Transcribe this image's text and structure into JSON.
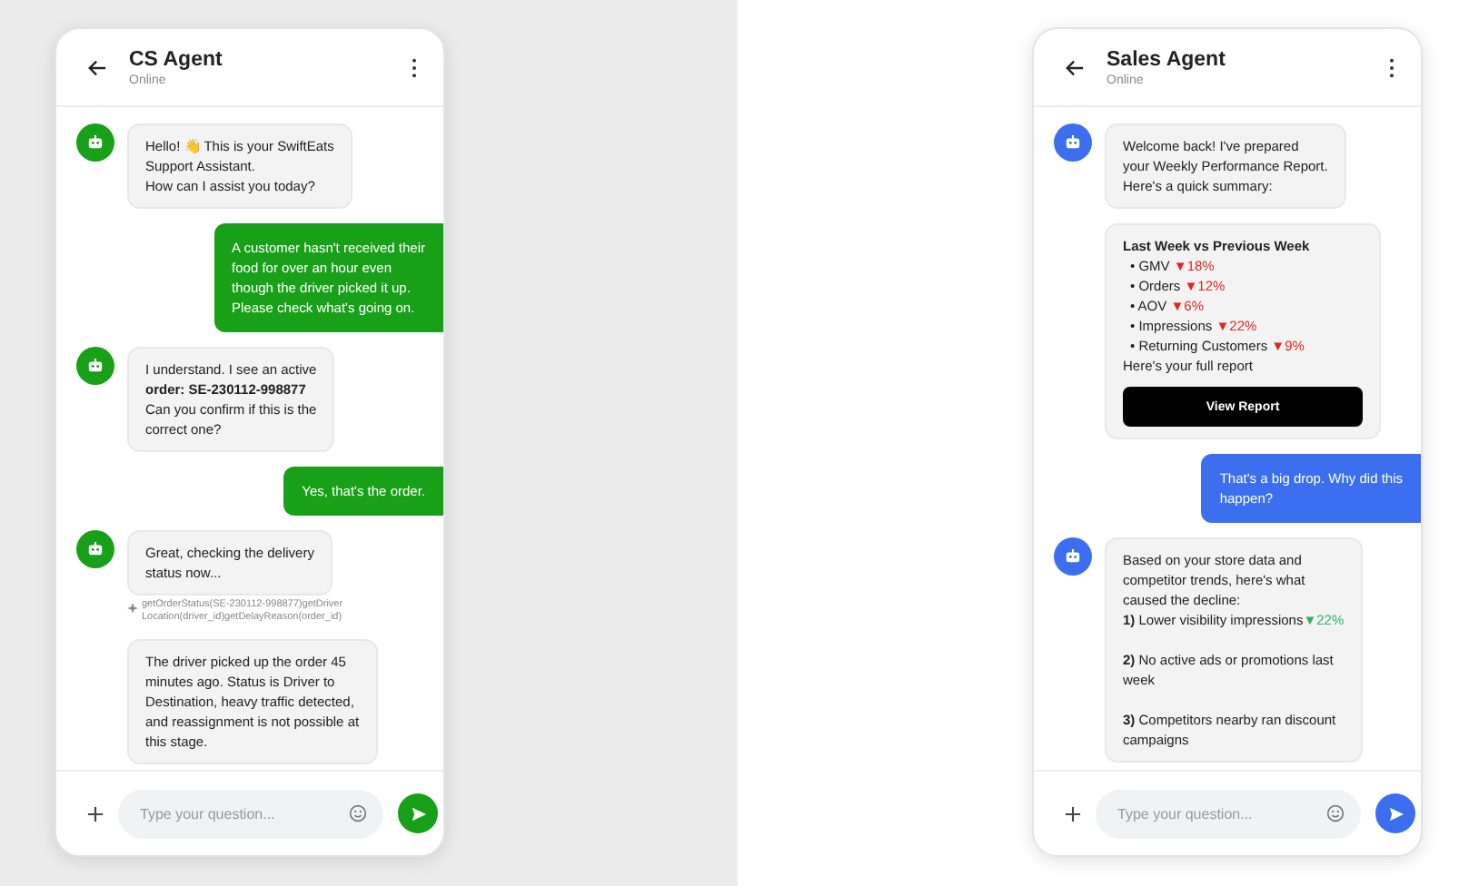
{
  "phones": [
    {
      "title": "CS Agent",
      "status": "Online",
      "color": "#18a018",
      "input": {
        "placeholder": "Type your question..."
      },
      "messages": [
        {
          "kind": "bot",
          "avatar": true,
          "blocks": [
            {
              "text": "Hello! 👋 This is your SwiftEats\nSupport Assistant.\nHow can I assist you today?"
            }
          ]
        },
        {
          "kind": "user",
          "text": "A customer hasn't received their\nfood for over an hour even\nthough the driver picked it up.\nPlease check what's going on."
        },
        {
          "kind": "bot",
          "avatar": true,
          "blocks": [
            {
              "text": "I understand. I see an active\n**order: SE-230112-998877**\nCan you confirm if this is the\ncorrect one?"
            }
          ]
        },
        {
          "kind": "user",
          "text": "Yes, that's the order."
        },
        {
          "kind": "bot",
          "avatar": true,
          "blocks": [
            {
              "text": "Great, checking the delivery\nstatus now..."
            }
          ]
        },
        {
          "kind": "tool",
          "text": "getOrderStatus(SE-230112-998877)getDriver\nLocation(driver_id)getDelayReason(order_id)"
        },
        {
          "kind": "bot",
          "avatar": false,
          "blocks": [
            {
              "text": "The driver picked up the order 45\nminutes ago. Status is Driver to\nDestination, heavy traffic detected,\nand reassignment is not possible at\nthis stage."
            }
          ]
        }
      ]
    },
    {
      "title": "Sales Agent",
      "status": "Online",
      "color": "#3b6ff0",
      "input": {
        "placeholder": "Type your question..."
      },
      "messages": [
        {
          "kind": "bot",
          "avatar": true,
          "blocks": [
            {
              "text": "Welcome back! I've prepared\nyour Weekly Performance Report.\nHere's a quick summary:"
            }
          ]
        },
        {
          "kind": "report",
          "title": "Last Week vs Previous Week",
          "items": [
            {
              "marker": "•",
              "label": "GMV",
              "change": "▼18%",
              "color": "#e02424"
            },
            {
              "marker": "•",
              "label": "Orders",
              "change": "▼12%",
              "color": "#e02424"
            },
            {
              "marker": "•",
              "label": "AOV",
              "change": "▼6%",
              "color": "#e02424"
            },
            {
              "marker": "•",
              "label": "Impressions",
              "change": "▼22%",
              "color": "#e02424"
            },
            {
              "marker": "•",
              "label": "Returning Customers",
              "change": "▼9%",
              "color": "#e02424"
            }
          ],
          "footer": "Here's your full report",
          "button": "View Report"
        },
        {
          "kind": "user",
          "text": "That's a big drop. Why did this\nhappen?"
        },
        {
          "kind": "bot",
          "avatar": true,
          "blocks": [
            {
              "text": "Based on your store data and\ncompetitor trends, here's what\ncaused the decline:\n**1)** Lower visibility impressions",
              "change": "▼22%",
              "color": "#2fb36b"
            },
            {
              "text": "**2)** No active ads or promotions last\nweek"
            },
            {
              "text": "**3)** Competitors nearby ran discount\ncampaigns"
            }
          ]
        }
      ]
    }
  ]
}
